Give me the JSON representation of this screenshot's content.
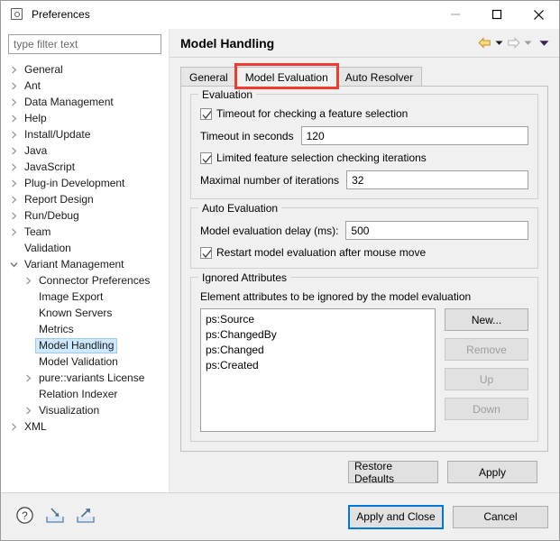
{
  "window": {
    "title": "Preferences",
    "icon": "preferences-icon",
    "controls": {
      "minimize": "minimize-icon",
      "maximize": "maximize-icon",
      "close": "close-icon"
    }
  },
  "sidebar": {
    "filter": {
      "placeholder": "type filter text",
      "value": ""
    },
    "items": [
      {
        "label": "General",
        "level": 0,
        "expandable": true,
        "expanded": false,
        "selected": false
      },
      {
        "label": "Ant",
        "level": 0,
        "expandable": true,
        "expanded": false,
        "selected": false
      },
      {
        "label": "Data Management",
        "level": 0,
        "expandable": true,
        "expanded": false,
        "selected": false
      },
      {
        "label": "Help",
        "level": 0,
        "expandable": true,
        "expanded": false,
        "selected": false
      },
      {
        "label": "Install/Update",
        "level": 0,
        "expandable": true,
        "expanded": false,
        "selected": false
      },
      {
        "label": "Java",
        "level": 0,
        "expandable": true,
        "expanded": false,
        "selected": false
      },
      {
        "label": "JavaScript",
        "level": 0,
        "expandable": true,
        "expanded": false,
        "selected": false
      },
      {
        "label": "Plug-in Development",
        "level": 0,
        "expandable": true,
        "expanded": false,
        "selected": false
      },
      {
        "label": "Report Design",
        "level": 0,
        "expandable": true,
        "expanded": false,
        "selected": false
      },
      {
        "label": "Run/Debug",
        "level": 0,
        "expandable": true,
        "expanded": false,
        "selected": false
      },
      {
        "label": "Team",
        "level": 0,
        "expandable": true,
        "expanded": false,
        "selected": false
      },
      {
        "label": "Validation",
        "level": 0,
        "expandable": false,
        "expanded": false,
        "selected": false
      },
      {
        "label": "Variant Management",
        "level": 0,
        "expandable": true,
        "expanded": true,
        "selected": false
      },
      {
        "label": "Connector Preferences",
        "level": 1,
        "expandable": true,
        "expanded": false,
        "selected": false
      },
      {
        "label": "Image Export",
        "level": 1,
        "expandable": false,
        "expanded": false,
        "selected": false
      },
      {
        "label": "Known Servers",
        "level": 1,
        "expandable": false,
        "expanded": false,
        "selected": false
      },
      {
        "label": "Metrics",
        "level": 1,
        "expandable": false,
        "expanded": false,
        "selected": false
      },
      {
        "label": "Model Handling",
        "level": 1,
        "expandable": false,
        "expanded": false,
        "selected": true
      },
      {
        "label": "Model Validation",
        "level": 1,
        "expandable": false,
        "expanded": false,
        "selected": false
      },
      {
        "label": "pure::variants License",
        "level": 1,
        "expandable": true,
        "expanded": false,
        "selected": false
      },
      {
        "label": "Relation Indexer",
        "level": 1,
        "expandable": false,
        "expanded": false,
        "selected": false
      },
      {
        "label": "Visualization",
        "level": 1,
        "expandable": true,
        "expanded": false,
        "selected": false
      },
      {
        "label": "XML",
        "level": 0,
        "expandable": true,
        "expanded": false,
        "selected": false
      }
    ]
  },
  "page": {
    "title": "Model Handling",
    "nav": {
      "back": "back-arrow-icon",
      "back_menu": "back-dropdown-icon",
      "forward": "forward-arrow-icon",
      "forward_menu": "forward-dropdown-icon",
      "view_menu": "view-menu-icon"
    }
  },
  "tabs": [
    {
      "label": "General",
      "active": false,
      "annotated": false
    },
    {
      "label": "Model Evaluation",
      "active": true,
      "annotated": true
    },
    {
      "label": "Auto Resolver",
      "active": false,
      "annotated": false
    }
  ],
  "annotation": {
    "color": "#ef3b31"
  },
  "evaluation": {
    "group_title": "Evaluation",
    "timeout_checkbox": {
      "label": "Timeout for checking a feature selection",
      "checked": true
    },
    "timeout_field": {
      "label": "Timeout in seconds",
      "value": "120"
    },
    "iterations_checkbox": {
      "label": "Limited feature selection checking iterations",
      "checked": true
    },
    "iterations_field": {
      "label": "Maximal number of iterations",
      "value": "32"
    }
  },
  "auto_evaluation": {
    "group_title": "Auto Evaluation",
    "delay_field": {
      "label": "Model evaluation delay (ms):",
      "value": "500"
    },
    "restart_checkbox": {
      "label": "Restart model evaluation after mouse move",
      "checked": true
    }
  },
  "ignored_attributes": {
    "group_title": "Ignored Attributes",
    "hint": "Element attributes to be ignored by the model evaluation",
    "items": [
      "ps:Source",
      "ps:ChangedBy",
      "ps:Changed",
      "ps:Created"
    ],
    "buttons": [
      {
        "label": "New...",
        "enabled": true
      },
      {
        "label": "Remove",
        "enabled": false
      },
      {
        "label": "Up",
        "enabled": false
      },
      {
        "label": "Down",
        "enabled": false
      }
    ]
  },
  "apply_bar": {
    "restore_defaults": "Restore Defaults",
    "apply": "Apply"
  },
  "footer": {
    "icons": [
      {
        "name": "help-icon"
      },
      {
        "name": "import-icon"
      },
      {
        "name": "export-icon"
      }
    ],
    "apply_and_close": "Apply and Close",
    "cancel": "Cancel"
  },
  "colors": {
    "selection": "#cde8ff",
    "focus_border": "#0078d7",
    "annotation": "#ef3b31",
    "back_arrow": "#e8a33d"
  }
}
